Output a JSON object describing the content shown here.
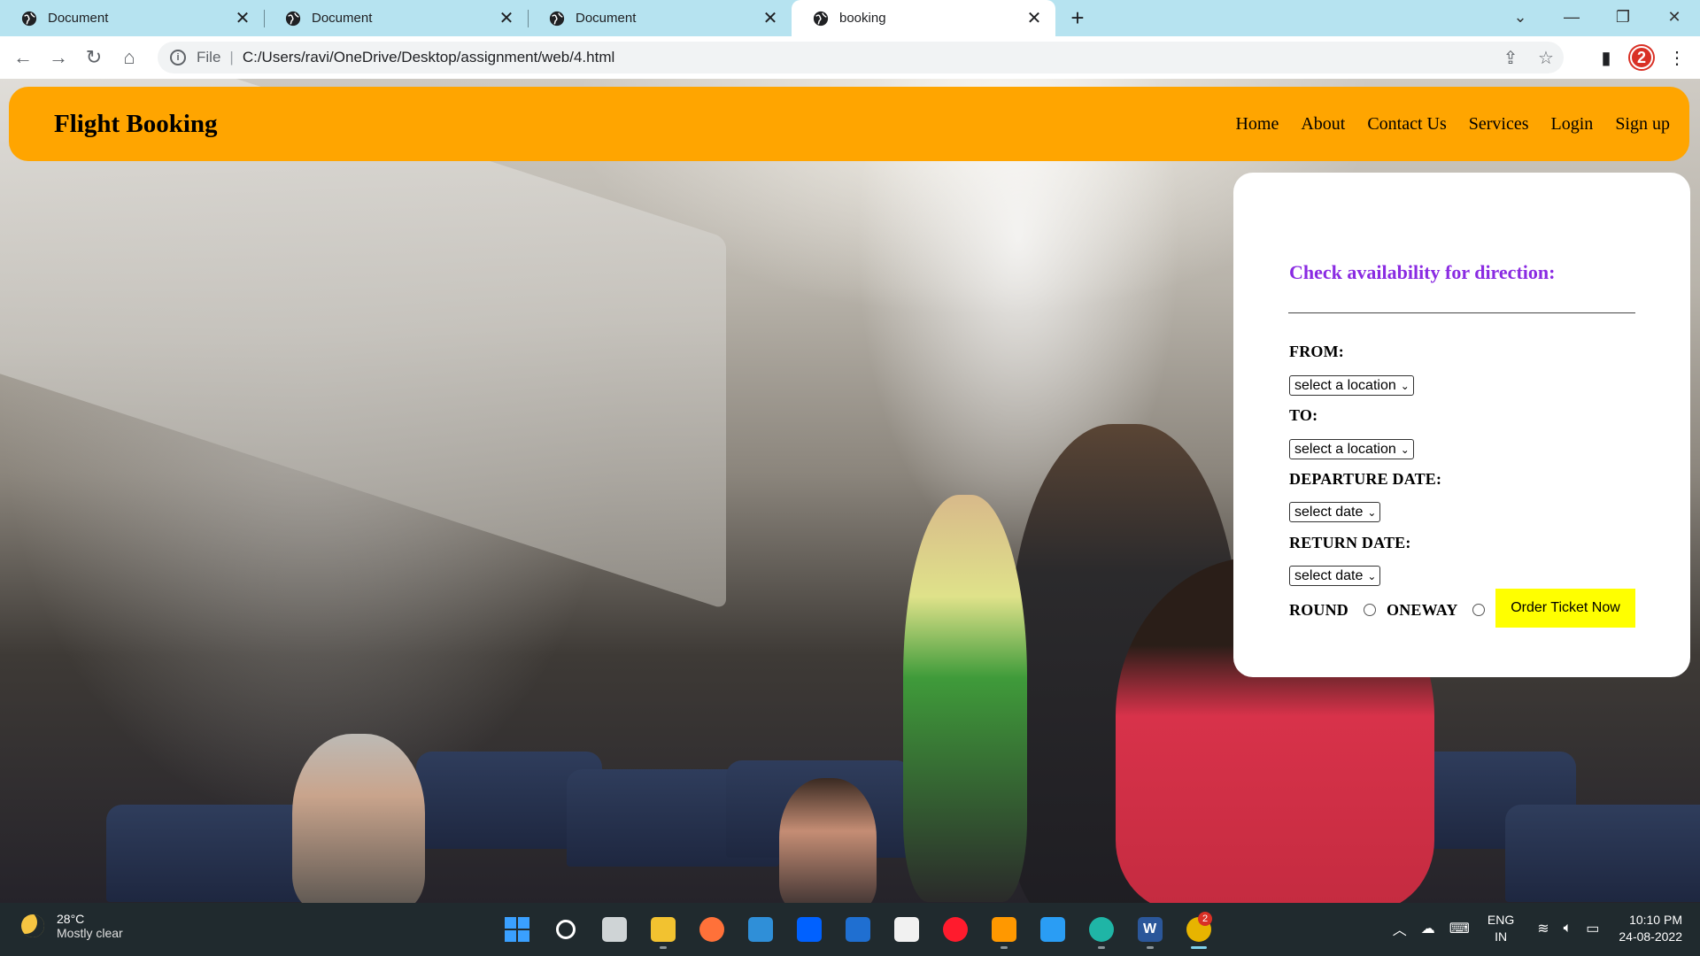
{
  "browser": {
    "tabs": [
      {
        "title": "Document",
        "active": false
      },
      {
        "title": "Document",
        "active": false
      },
      {
        "title": "Document",
        "active": false
      },
      {
        "title": "booking",
        "active": true
      }
    ],
    "address": {
      "scheme_label": "File",
      "path": "C:/Users/ravi/OneDrive/Desktop/assignment/web/4.html"
    },
    "extension_badge": "2",
    "icons": {
      "back": "back-arrow-icon",
      "forward": "forward-arrow-icon",
      "reload": "reload-icon",
      "home": "home-icon",
      "share": "share-icon",
      "star": "bookmark-star-icon",
      "sidepanel": "side-panel-icon",
      "menu": "kebab-menu-icon"
    }
  },
  "site": {
    "brand": "Flight Booking",
    "nav": [
      "Home",
      "About",
      "Contact Us",
      "Services",
      "Login",
      "Sign up"
    ],
    "colors": {
      "header": "#ffa500",
      "heading": "#8a2be2",
      "button": "#ffff00"
    }
  },
  "form": {
    "heading": "Check availability for direction:",
    "from_label": "FROM:",
    "from_value": "select a location",
    "to_label": "TO:",
    "to_value": "select a location",
    "departure_label": "DEPARTURE DATE:",
    "departure_value": "select date",
    "return_label": "RETURN DATE:",
    "return_value": "select date",
    "round_label": "ROUND",
    "oneway_label": "ONEWAY",
    "order_button": "Order Ticket Now"
  },
  "taskbar": {
    "temperature": "28°C",
    "weather": "Mostly clear",
    "apps": [
      {
        "name": "windows-start-icon",
        "label": "",
        "color": "#3aa0ff"
      },
      {
        "name": "search-icon",
        "label": "",
        "color": "transparent"
      },
      {
        "name": "task-view-icon",
        "label": "",
        "color": "#cfd4d6"
      },
      {
        "name": "file-explorer-icon",
        "label": "",
        "color": "#f2c230"
      },
      {
        "name": "firefox-icon",
        "label": "",
        "color": "#ff7139"
      },
      {
        "name": "mail-icon",
        "label": "",
        "color": "#2f8fd8"
      },
      {
        "name": "dropbox-icon",
        "label": "",
        "color": "#0061ff"
      },
      {
        "name": "security-app-icon",
        "label": "",
        "color": "#1f6fd1"
      },
      {
        "name": "store-icon",
        "label": "",
        "color": "#f1f1f1"
      },
      {
        "name": "opera-icon",
        "label": "",
        "color": "#ff1b2d"
      },
      {
        "name": "sublime-text-icon",
        "label": "",
        "color": "#ff9800"
      },
      {
        "name": "vscode-icon",
        "label": "",
        "color": "#2a9df4"
      },
      {
        "name": "edge-icon",
        "label": "",
        "color": "#1fb5a6"
      },
      {
        "name": "word-icon",
        "label": "W",
        "color": "#2b579a"
      },
      {
        "name": "chrome-icon",
        "label": "",
        "color": "#e7b400",
        "badge": "2"
      }
    ],
    "lang_top": "ENG",
    "lang_bottom": "IN",
    "time": "10:10 PM",
    "date": "24-08-2022"
  }
}
